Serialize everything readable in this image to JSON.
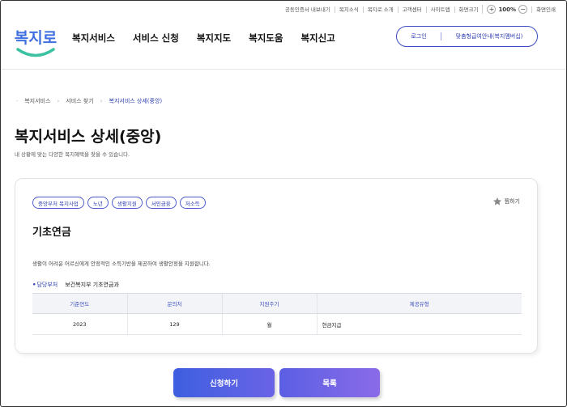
{
  "utility": {
    "links": [
      "공동인증서 내보내기",
      "복지소식",
      "복지로 소개",
      "고객센터",
      "사이트맵",
      "화면크기"
    ],
    "zoom_minus": "−",
    "zoom_value": "100%",
    "zoom_plus": "+",
    "print": "화면인쇄"
  },
  "header": {
    "logo_text": "복지로",
    "nav": [
      "복지서비스",
      "서비스 신청",
      "복지지도",
      "복지도움",
      "복지신고"
    ],
    "login": "로그인",
    "my_info": "맞춤형급여안내(복지멤버십)"
  },
  "breadcrumb": [
    "복지서비스",
    "서비스 찾기",
    "복지서비스 상세(중앙)"
  ],
  "page": {
    "title": "복지서비스 상세(중앙)",
    "subtitle": "내 상황에 맞는 다양한 복지혜택을 찾을 수 있습니다."
  },
  "service": {
    "tags": [
      "중앙부처 복지사업",
      "노년",
      "생활지원",
      "서민금융",
      "저소득"
    ],
    "favorite_label": "찜하기",
    "title": "기초연금",
    "description": "생활이 어려운 어르신에게 안정적인 소득기반을 제공하여 생활안정을 지원합니다.",
    "dept_label": "담당부처",
    "dept_value": "보건복지부 기초연금과",
    "table": {
      "headers": [
        "기준연도",
        "문의처",
        "지원주기",
        "제공유형"
      ],
      "row": [
        "2023",
        "129",
        "월",
        "현금지급"
      ]
    }
  },
  "actions": {
    "apply": "신청하기",
    "list": "목록"
  },
  "colors": {
    "brand": "#2f3fb0",
    "logo_blue": "#3f6fe0",
    "logo_green": "#3cc2a0"
  }
}
